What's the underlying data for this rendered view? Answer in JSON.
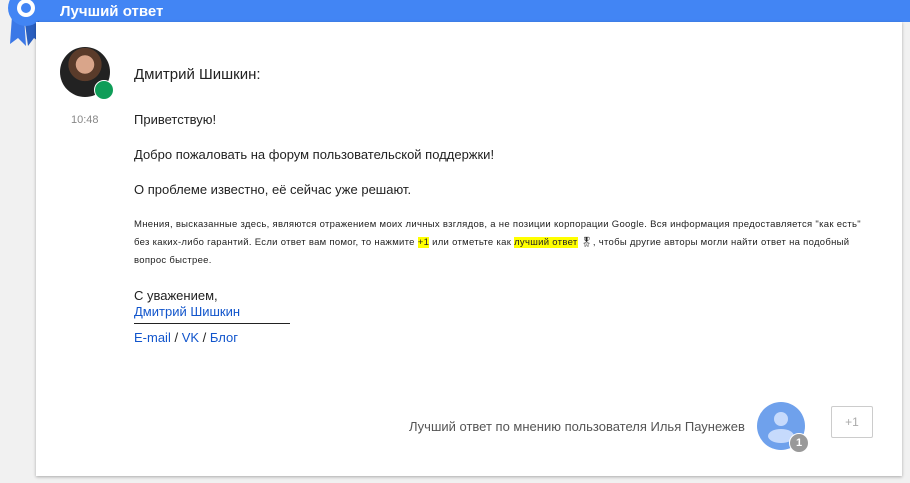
{
  "header": {
    "title": "Лучший ответ"
  },
  "post": {
    "author": "Дмитрий Шишкин:",
    "time": "10:48",
    "paragraphs": [
      "Приветствую!",
      "Добро пожаловать на форум пользовательской поддержки!",
      "О проблеме известно, её сейчас уже решают."
    ],
    "disclaimer": {
      "part1": "Мнения, высказанные здесь, являются отражением моих личных взглядов, а не позиции корпорации Google. Вся информация предоставляется \"как есть\" без каких-либо гарантий. Если ответ вам помог, то нажмите ",
      "plus": "+1",
      "part2": " или отметьте как ",
      "best": "лучший ответ",
      "part3": ", чтобы другие авторы могли найти ответ на подобный вопрос быстрее."
    },
    "regards": "С уважением,",
    "signature": "Дмитрий Шишкин",
    "links": {
      "email": "E-mail",
      "sep": " / ",
      "vk": "VK",
      "blog": "Блог"
    }
  },
  "footer": {
    "best_by": "Лучший ответ по мнению пользователя Илья Паунежев",
    "vote_count": "1",
    "plus_one": "+1"
  },
  "colors": {
    "header": "#4285f4",
    "link": "#1155cc",
    "highlight": "#ffff00"
  }
}
